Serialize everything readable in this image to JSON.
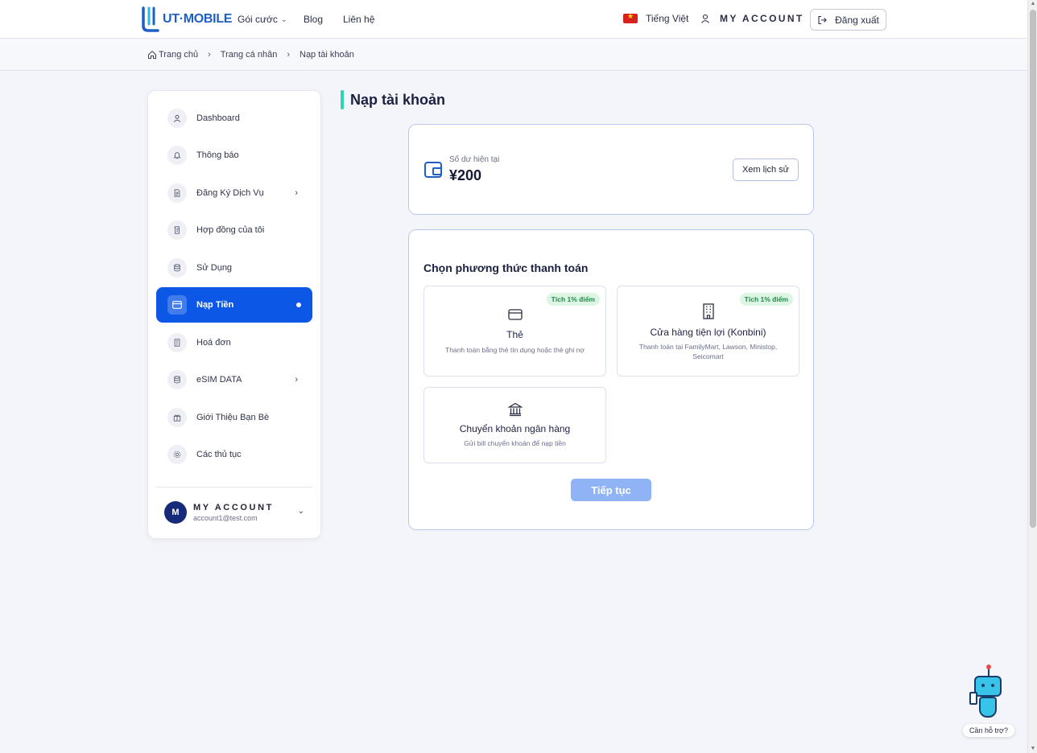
{
  "header": {
    "logo_text": "UT·MOBILE",
    "nav": [
      {
        "label": "Gói cước",
        "has_dropdown": true
      },
      {
        "label": "Blog"
      },
      {
        "label": "Liên hệ"
      }
    ],
    "language": "Tiếng Việt",
    "account_label": "MY ACCOUNT",
    "logout_label": "Đăng xuất"
  },
  "breadcrumb": [
    "Trang chủ",
    "Trang cá nhân",
    "Nạp tài khoản"
  ],
  "sidebar": {
    "items": [
      {
        "label": "Dashboard",
        "icon": "user-icon"
      },
      {
        "label": "Thông báo",
        "icon": "bell-icon"
      },
      {
        "label": "Đăng Ký Dịch Vụ",
        "icon": "document-icon",
        "has_arrow": true
      },
      {
        "label": "Hợp đồng của tôi",
        "icon": "contract-icon"
      },
      {
        "label": "Sử Dụng",
        "icon": "database-icon"
      },
      {
        "label": "Nạp Tiền",
        "icon": "card-icon",
        "active": true
      },
      {
        "label": "Hoá đơn",
        "icon": "invoice-icon"
      },
      {
        "label": "eSIM DATA",
        "icon": "database-icon",
        "has_arrow": true
      },
      {
        "label": "Giới Thiệu Bạn Bè",
        "icon": "gift-icon"
      },
      {
        "label": "Các thủ tục",
        "icon": "gear-icon"
      }
    ],
    "user": {
      "initial": "M",
      "name": "MY ACCOUNT",
      "email": "account1@test.com"
    }
  },
  "main": {
    "title": "Nạp tài khoản",
    "balance": {
      "label": "Số dư hiện tại",
      "value": "¥200",
      "history_button": "Xem lịch sử"
    },
    "payment": {
      "title": "Chọn phương thức thanh toán",
      "options": [
        {
          "name": "Thẻ",
          "desc": "Thanh toán bằng thẻ tín dụng hoặc thẻ ghi nợ",
          "badge": "Tích 1% điểm",
          "icon": "credit-card-icon"
        },
        {
          "name": "Cửa hàng tiện lợi (Konbini)",
          "desc": "Thanh toán tại FamilyMart, Lawson, Ministop, Seicomart",
          "badge": "Tích 1% điểm",
          "icon": "building-icon"
        },
        {
          "name": "Chuyển khoản ngân hàng",
          "desc": "Gửi bill chuyển khoản để nạp tiền",
          "icon": "bank-icon"
        }
      ],
      "continue_button": "Tiếp tục"
    }
  },
  "help": {
    "label": "Cần hỗ trợ?"
  },
  "colors": {
    "primary": "#0d57e6",
    "accent_bar": "#2ad6b4",
    "badge_bg": "#dcf5e4",
    "badge_text": "#1f8a47",
    "continue_disabled": "#8fb3f5"
  }
}
